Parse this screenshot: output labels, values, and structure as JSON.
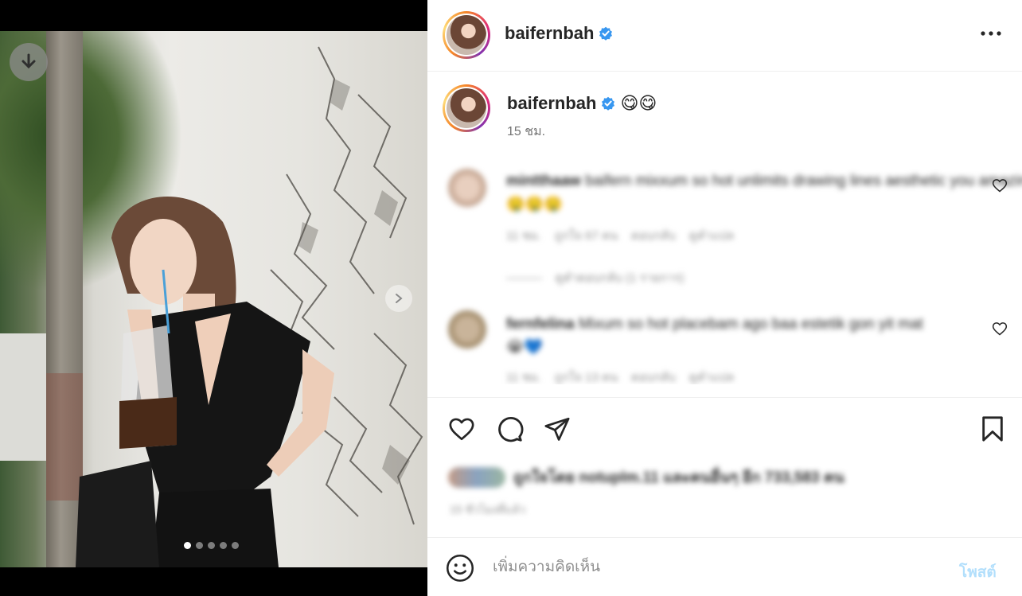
{
  "post": {
    "username": "baifernbah",
    "verified": true,
    "caption_emoji": "😋😋",
    "time": "15 ชม."
  },
  "media": {
    "slide_count": 5,
    "active_slide": 1
  },
  "comments": [
    {
      "username": "mintthaaw",
      "text": "baifern mixxum so hot unlimits drawing lines aesthetic you amazing deserve cute mit",
      "emoji": "🤤🤤🤤",
      "time": "11 ชม.",
      "likes": "ถูกใจ 67 คน",
      "reply": "ตอบกลับ",
      "see_translation": "ดูคำแปล",
      "view_replies": "ดูคำตอบกลับ (1 รายการ)"
    },
    {
      "username": "fernfelina",
      "text": "Mixum so hot placebam ago baa estetik gon yit mat",
      "emoji": "😭💙",
      "time": "11 ชม.",
      "likes": "ถูกใจ 13 คน",
      "reply": "ตอบกลับ",
      "see_translation": "ดูคำแปล"
    }
  ],
  "actions": {
    "like": "heart-icon",
    "comment": "comment-icon",
    "share": "send-icon",
    "save": "bookmark-icon"
  },
  "likes_text": "ถูกใจโดย notuplm.11 และคนอื่นๆ อีก 733,583 คน",
  "post_date": "15 ชั่วโมงที่แล้ว",
  "compose": {
    "placeholder": "เพิ่มความคิดเห็น",
    "post_label": "โพสต์"
  }
}
